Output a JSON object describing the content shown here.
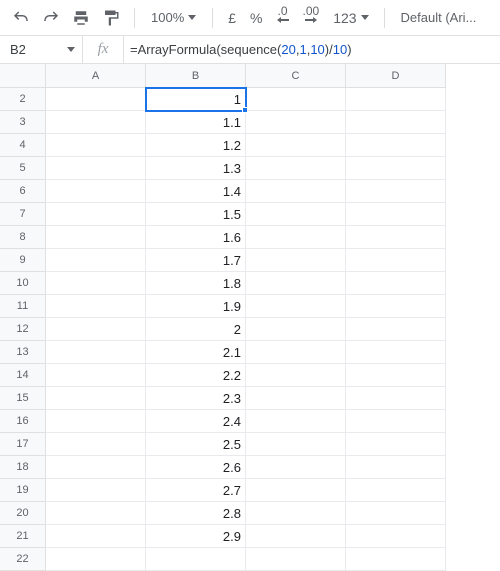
{
  "toolbar": {
    "zoom": "100%",
    "currency": "£",
    "percent": "%",
    "dec_less": ".0",
    "dec_more": ".00",
    "num_format": "123",
    "font_label": "Default (Ari..."
  },
  "formula_bar": {
    "cell_ref": "B2",
    "fx_label": "fx",
    "formula_plain": "=ArrayFormula(sequence(20,1,10)/10)",
    "tokens": {
      "t0": "=ArrayFormula(sequence(",
      "n0": "20",
      "c0": ",",
      "n1": "1",
      "c1": ",",
      "n2": "10",
      "t1": ")/",
      "n3": "10",
      "t2": ")"
    }
  },
  "columns": [
    "A",
    "B",
    "C",
    "D"
  ],
  "rows": [
    "2",
    "3",
    "4",
    "5",
    "6",
    "7",
    "8",
    "9",
    "10",
    "11",
    "12",
    "13",
    "14",
    "15",
    "16",
    "17",
    "18",
    "19",
    "20",
    "21",
    "22"
  ],
  "cells": {
    "B": [
      "1",
      "1.1",
      "1.2",
      "1.3",
      "1.4",
      "1.5",
      "1.6",
      "1.7",
      "1.8",
      "1.9",
      "2",
      "2.1",
      "2.2",
      "2.3",
      "2.4",
      "2.5",
      "2.6",
      "2.7",
      "2.8",
      "2.9",
      ""
    ]
  },
  "selected": "B2",
  "chart_data": {
    "type": "table",
    "title": "",
    "columns": [
      "row",
      "B"
    ],
    "rows": [
      [
        2,
        1
      ],
      [
        3,
        1.1
      ],
      [
        4,
        1.2
      ],
      [
        5,
        1.3
      ],
      [
        6,
        1.4
      ],
      [
        7,
        1.5
      ],
      [
        8,
        1.6
      ],
      [
        9,
        1.7
      ],
      [
        10,
        1.8
      ],
      [
        11,
        1.9
      ],
      [
        12,
        2
      ],
      [
        13,
        2.1
      ],
      [
        14,
        2.2
      ],
      [
        15,
        2.3
      ],
      [
        16,
        2.4
      ],
      [
        17,
        2.5
      ],
      [
        18,
        2.6
      ],
      [
        19,
        2.7
      ],
      [
        20,
        2.8
      ],
      [
        21,
        2.9
      ]
    ]
  }
}
